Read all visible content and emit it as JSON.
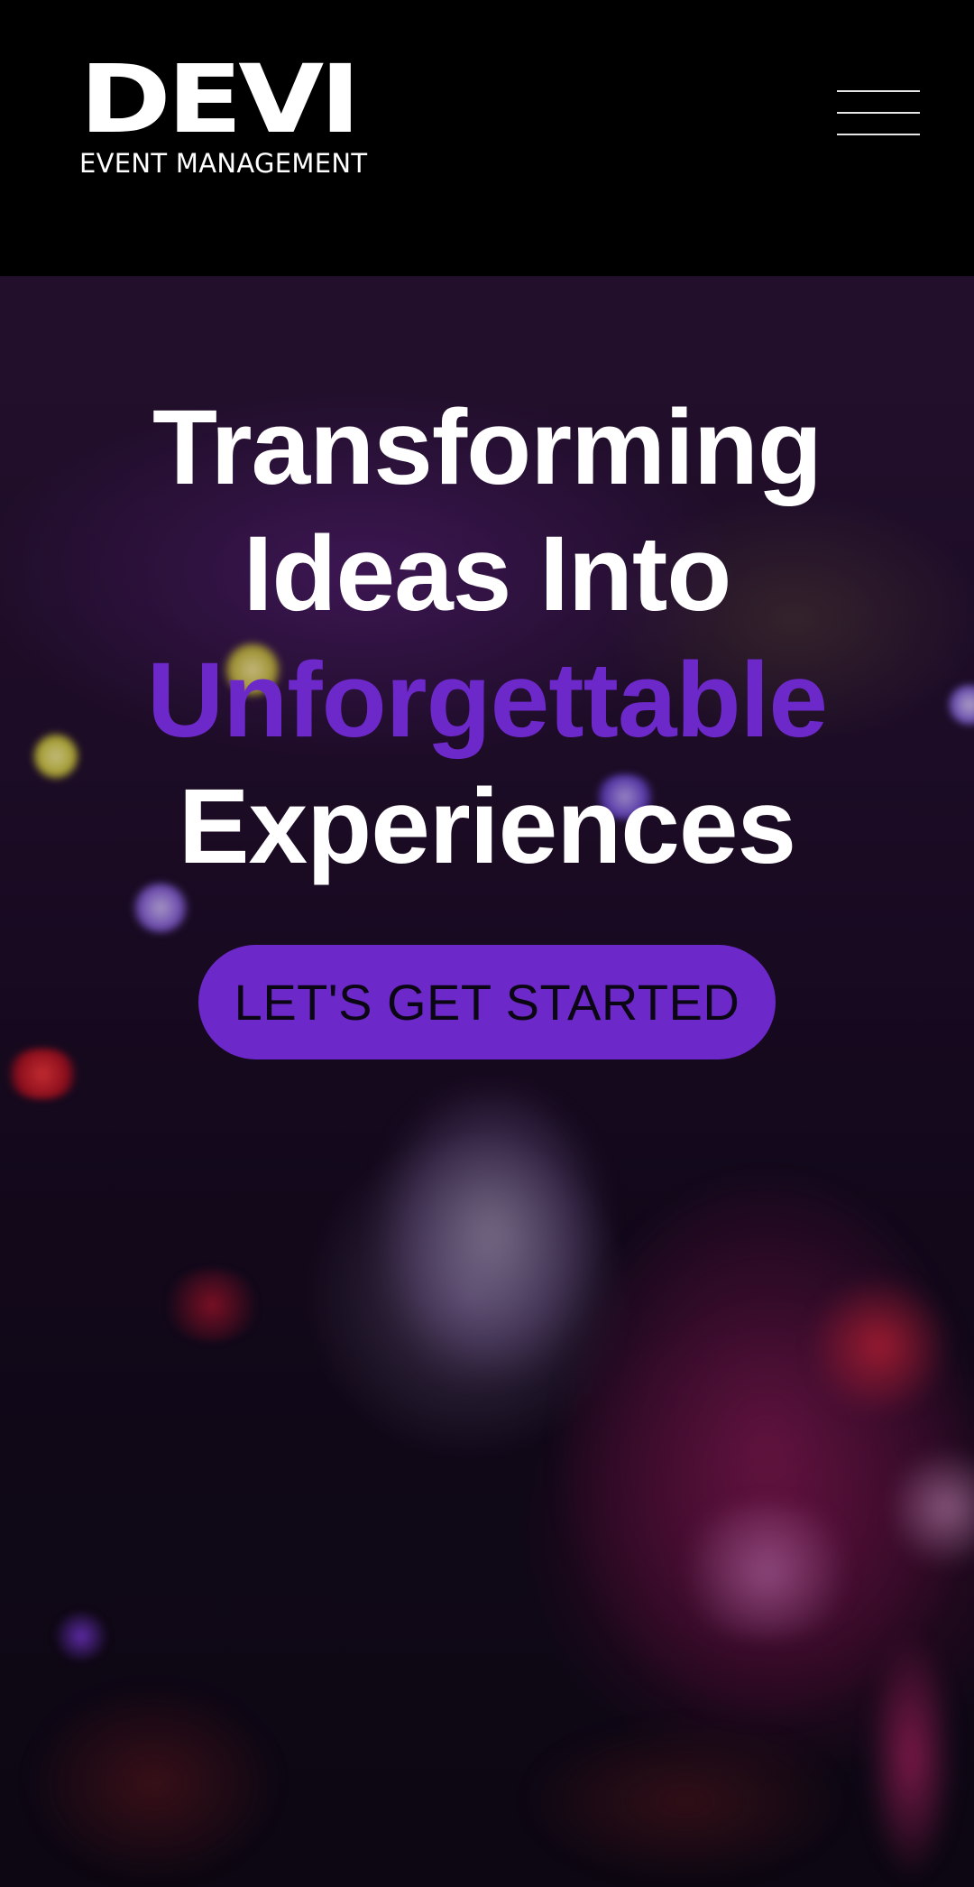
{
  "header": {
    "logo_text": "DEVI",
    "logo_subtitle": "EVENT MANAGEMENT",
    "menu_icon": "hamburger-menu-icon"
  },
  "hero": {
    "headline_line1": "Transforming",
    "headline_line2": "Ideas Into",
    "headline_accent": "Unforgettable",
    "headline_line4": "Experiences",
    "cta_label": "LET'S GET STARTED",
    "background_image": "event-venue-flowers-photo"
  },
  "colors": {
    "accent": "#6d28c9",
    "header_background": "#000000",
    "text": "#ffffff"
  }
}
